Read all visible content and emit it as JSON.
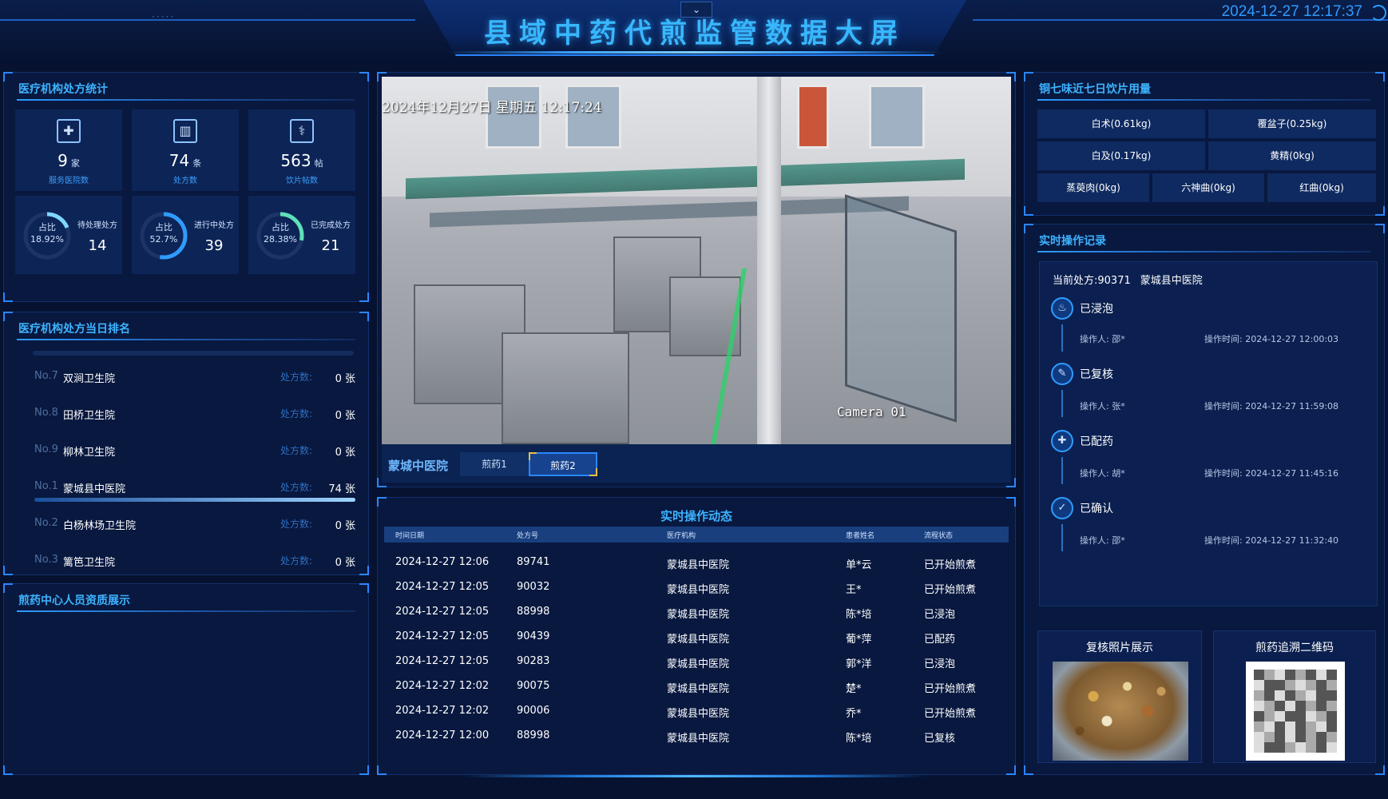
{
  "header": {
    "title": "县域中药代煎监管数据大屏",
    "datetime": "2024-12-27 12:17:37",
    "dots": "·····"
  },
  "institution_stats": {
    "title": "医疗机构处方统计",
    "cards": [
      {
        "icon": "hospital-plus-icon",
        "value": "9",
        "unit": "家",
        "label": "服务医院数"
      },
      {
        "icon": "building-icon",
        "value": "74",
        "unit": "条",
        "label": "处方数"
      },
      {
        "icon": "medicine-icon",
        "value": "563",
        "unit": "帖",
        "label": "饮片帖数"
      }
    ],
    "rings": [
      {
        "prefix": "占比",
        "percent_text": "18.92%",
        "percent": 18.92,
        "label": "待处理处方",
        "value": "14"
      },
      {
        "prefix": "占比",
        "percent_text": "52.7%",
        "percent": 52.7,
        "label": "进行中处方",
        "value": "39"
      },
      {
        "prefix": "占比",
        "percent_text": "28.38%",
        "percent": 28.38,
        "label": "已完成处方",
        "value": "21"
      }
    ]
  },
  "ranking": {
    "title": "医疗机构处方当日排名",
    "field_label": "处方数:",
    "rows": [
      {
        "no": "No.7",
        "name": "双涧卫生院",
        "value": "0 张",
        "fill": 0
      },
      {
        "no": "No.8",
        "name": "田桥卫生院",
        "value": "0 张",
        "fill": 0
      },
      {
        "no": "No.9",
        "name": "柳林卫生院",
        "value": "0 张",
        "fill": 0
      },
      {
        "no": "No.1",
        "name": "蒙城县中医院",
        "value": "74 张",
        "fill": 1.0
      },
      {
        "no": "No.2",
        "name": "白杨林场卫生院",
        "value": "0 张",
        "fill": 0
      },
      {
        "no": "No.3",
        "name": "篱笆卫生院",
        "value": "0 张",
        "fill": 0
      }
    ]
  },
  "staff": {
    "title": "煎药中心人员资质展示"
  },
  "video": {
    "overlay_time": "2024年12月27日  星期五  12:17:24",
    "camera": "Camera 01",
    "org": "蒙城中医院",
    "tabs": [
      "煎药1",
      "煎药2"
    ],
    "active_tab": 1
  },
  "realtime": {
    "title": "实时操作动态",
    "columns": [
      "时间日期",
      "处方号",
      "医疗机构",
      "患者姓名",
      "流程状态"
    ],
    "rows": [
      [
        "2024-12-27 12:06",
        "89741",
        "蒙城县中医院",
        "单*云",
        "已开始煎煮"
      ],
      [
        "2024-12-27 12:05",
        "90032",
        "蒙城县中医院",
        "王*",
        "已开始煎煮"
      ],
      [
        "2024-12-27 12:05",
        "88998",
        "蒙城县中医院",
        "陈*培",
        "已浸泡"
      ],
      [
        "2024-12-27 12:05",
        "90439",
        "蒙城县中医院",
        "葡*萍",
        "已配药"
      ],
      [
        "2024-12-27 12:05",
        "90283",
        "蒙城县中医院",
        "郭*洋",
        "已浸泡"
      ],
      [
        "2024-12-27 12:02",
        "90075",
        "蒙城县中医院",
        "楚*",
        "已开始煎煮"
      ],
      [
        "2024-12-27 12:02",
        "90006",
        "蒙城县中医院",
        "乔*",
        "已开始煎煮"
      ],
      [
        "2024-12-27 12:00",
        "88998",
        "蒙城县中医院",
        "陈*培",
        "已复核"
      ]
    ]
  },
  "herbs": {
    "title": "铜七味近七日饮片用量",
    "row1": [
      "白术(0.61kg)",
      "覆盆子(0.25kg)"
    ],
    "row2": [
      "白及(0.17kg)",
      "黄精(0kg)"
    ],
    "row3": [
      "蒸萸肉(0kg)",
      "六神曲(0kg)",
      "红曲(0kg)"
    ]
  },
  "operation_log": {
    "title": "实时操作记录",
    "current_label": "当前处方:90371",
    "current_org": "蒙城县中医院",
    "op_label": "操作人:",
    "time_label": "操作时间:",
    "steps": [
      {
        "icon": "soak-icon",
        "status": "已浸泡",
        "operator": "邵*",
        "time": "2024-12-27 12:00:03"
      },
      {
        "icon": "review-icon",
        "status": "已复核",
        "operator": "张*",
        "time": "2024-12-27 11:59:08"
      },
      {
        "icon": "dispense-icon",
        "status": "已配药",
        "operator": "胡*",
        "time": "2024-12-27 11:45:16"
      },
      {
        "icon": "confirm-icon",
        "status": "已确认",
        "operator": "邵*",
        "time": "2024-12-27 11:32:40"
      }
    ]
  },
  "review_photo": {
    "title": "复核照片展示"
  },
  "trace_qr": {
    "title": "煎药追溯二维码"
  },
  "colors": {
    "accent": "#2f9bff",
    "title": "#38b7ff",
    "panel": "#0d2456",
    "background": "#061230"
  }
}
